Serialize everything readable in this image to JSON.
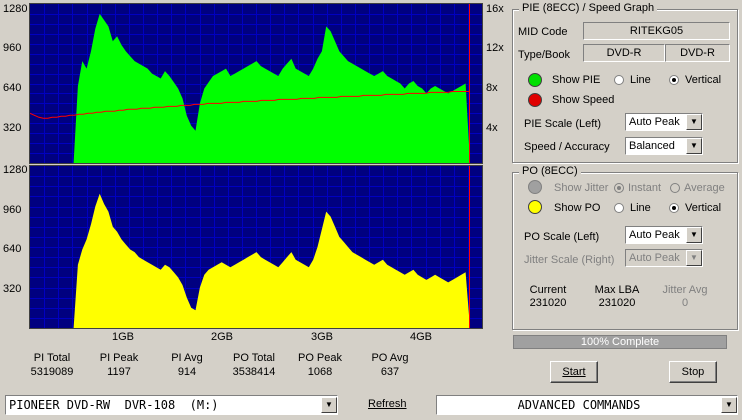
{
  "pie_graph": {
    "y_left_ticks": [
      "1280",
      "960",
      "640",
      "320"
    ],
    "y_right_ticks": [
      "16x",
      "12x",
      "8x",
      "4x"
    ]
  },
  "po_graph": {
    "y_left_ticks": [
      "1280",
      "960",
      "640",
      "320"
    ],
    "x_ticks": [
      "1GB",
      "2GB",
      "3GB",
      "4GB"
    ]
  },
  "stats": {
    "labels": [
      "PI Total",
      "PI Peak",
      "PI Avg",
      "PO Total",
      "PO Peak",
      "PO Avg"
    ],
    "values": [
      "5319089",
      "1197",
      "914",
      "3538414",
      "1068",
      "637"
    ]
  },
  "pie_panel": {
    "title": "PIE (8ECC) / Speed Graph",
    "mid_code_label": "MID Code",
    "mid_code_value": "RITEKG05",
    "type_book_label": "Type/Book",
    "type_value": "DVD-R",
    "book_value": "DVD-R",
    "show_pie_label": "Show PIE",
    "line_label": "Line",
    "vertical_label": "Vertical",
    "show_speed_label": "Show Speed",
    "pie_scale_label": "PIE Scale (Left)",
    "pie_scale_value": "Auto Peak",
    "speed_accuracy_label": "Speed / Accuracy",
    "speed_accuracy_value": "Balanced"
  },
  "po_panel": {
    "title": "PO (8ECC)",
    "show_jitter_label": "Show Jitter",
    "instant_label": "Instant",
    "average_label": "Average",
    "show_po_label": "Show PO",
    "line_label": "Line",
    "vertical_label": "Vertical",
    "po_scale_label": "PO Scale (Left)",
    "po_scale_value": "Auto Peak",
    "jitter_scale_label": "Jitter Scale (Right)",
    "jitter_scale_value": "Auto Peak",
    "current_label": "Current",
    "current_value": "231020",
    "max_lba_label": "Max LBA",
    "max_lba_value": "231020",
    "jitter_avg_label": "Jitter Avg",
    "jitter_avg_value": "0"
  },
  "progress": {
    "text": "100% Complete",
    "fraction": 1.0
  },
  "buttons": {
    "start": "Start",
    "stop": "Stop"
  },
  "bottom": {
    "drive": "PIONEER DVD-RW  DVR-108  (M:)",
    "refresh": "Refresh",
    "commands": "ADVANCED COMMANDS"
  },
  "colors": {
    "pie_fill": "#00ff00",
    "po_fill": "#ffff00",
    "speed_line": "#ff0000",
    "grid": "#0000c0",
    "graph_bg": "#000080",
    "end_marker": "#ff0000"
  },
  "chart_data": [
    {
      "type": "area",
      "series": [
        {
          "values": [
            0,
            0,
            0,
            0,
            0,
            0,
            0,
            0,
            0,
            0,
            0,
            620,
            820,
            760,
            900,
            1080,
            1200,
            1150,
            1100,
            980,
            1020,
            950,
            900,
            860,
            820,
            800,
            780,
            760,
            720,
            700,
            680,
            740,
            700,
            650,
            600,
            520,
            380,
            300,
            260,
            480,
            600,
            650,
            700,
            720,
            740,
            760,
            700,
            720,
            740,
            760,
            780,
            800,
            820,
            780,
            760,
            740,
            720,
            700,
            760,
            800,
            840,
            760,
            740,
            720,
            700,
            760,
            840,
            900,
            1100,
            1060,
            980,
            900,
            860,
            820,
            800,
            780,
            760,
            740,
            720,
            700,
            720,
            740,
            700,
            680,
            660,
            640,
            600,
            640,
            660,
            620,
            600,
            560,
            600,
            620,
            600,
            580,
            560,
            580,
            600,
            620,
            640,
            0
          ]
        },
        {
          "values": [
            5.0,
            4.8,
            4.6,
            4.5,
            4.5,
            4.6,
            4.6,
            4.7,
            4.7,
            4.8,
            4.8,
            4.9,
            4.9,
            5.0,
            5.0,
            5.1,
            5.1,
            5.2,
            5.2,
            5.2,
            5.3,
            5.3,
            5.4,
            5.4,
            5.4,
            5.5,
            5.5,
            5.5,
            5.6,
            5.6,
            5.6,
            5.7,
            5.7,
            5.7,
            5.8,
            5.8,
            5.8,
            5.9,
            5.9,
            5.9,
            6.0,
            6.0,
            6.0,
            6.0,
            6.1,
            6.1,
            6.1,
            6.1,
            6.2,
            6.2,
            6.2,
            6.2,
            6.3,
            6.3,
            6.3,
            6.3,
            6.4,
            6.4,
            6.4,
            6.4,
            6.4,
            6.5,
            6.5,
            6.5,
            6.5,
            6.6,
            6.6,
            6.6,
            6.6,
            6.6,
            6.7,
            6.7,
            6.7,
            6.7,
            6.7,
            6.8,
            6.8,
            6.8,
            6.8,
            6.8,
            6.9,
            6.9,
            6.9,
            6.9,
            6.9,
            7.0,
            7.0,
            7.0,
            7.0,
            7.0,
            7.1,
            7.1,
            7.1,
            7.1,
            7.1,
            7.2,
            7.2,
            7.2,
            7.2,
            7.2
          ]
        }
      ],
      "ylim": [
        0,
        1280
      ],
      "y2lim": [
        0,
        16
      ]
    },
    {
      "type": "area",
      "series": [
        {
          "values": [
            0,
            0,
            0,
            0,
            0,
            0,
            0,
            0,
            0,
            0,
            0,
            500,
            620,
            700,
            820,
            960,
            1060,
            980,
            920,
            800,
            760,
            700,
            660,
            620,
            600,
            560,
            540,
            520,
            500,
            480,
            460,
            500,
            480,
            440,
            400,
            340,
            240,
            160,
            140,
            320,
            420,
            460,
            480,
            500,
            520,
            500,
            480,
            500,
            520,
            540,
            560,
            580,
            600,
            560,
            540,
            520,
            500,
            480,
            520,
            560,
            600,
            540,
            520,
            500,
            480,
            540,
            640,
            780,
            920,
            880,
            800,
            720,
            680,
            640,
            600,
            580,
            560,
            540,
            520,
            500,
            520,
            540,
            500,
            480,
            460,
            440,
            420,
            440,
            460,
            420,
            400,
            380,
            400,
            420,
            400,
            380,
            360,
            380,
            400,
            420,
            440,
            0
          ]
        }
      ],
      "ylim": [
        0,
        1280
      ]
    }
  ]
}
